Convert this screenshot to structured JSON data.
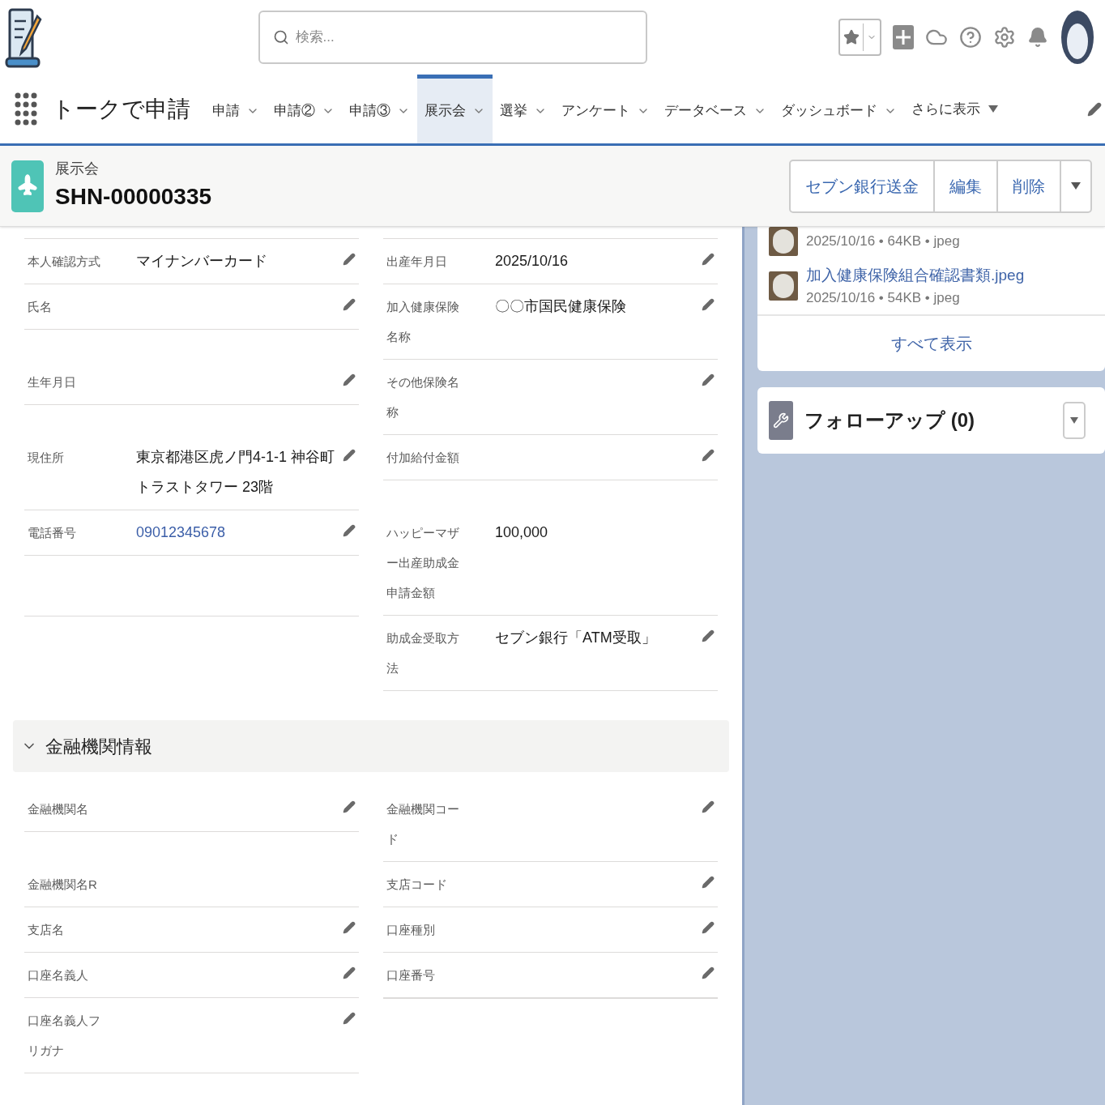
{
  "search": {
    "placeholder": "検索..."
  },
  "nav": {
    "app_name": "トークで申請",
    "tabs": [
      {
        "label": "申請",
        "selected": false
      },
      {
        "label": "申請②",
        "selected": false
      },
      {
        "label": "申請③",
        "selected": false
      },
      {
        "label": "展示会",
        "selected": true
      },
      {
        "label": "選挙",
        "selected": false
      },
      {
        "label": "アンケート",
        "selected": false
      },
      {
        "label": "データベース",
        "selected": false
      },
      {
        "label": "ダッシュボード",
        "selected": false
      }
    ],
    "more": "さらに表示"
  },
  "record": {
    "object": "展示会",
    "title": "SHN-00000335",
    "actions": [
      "セブン銀行送金",
      "編集",
      "削除"
    ]
  },
  "sections": [
    {
      "rows": [
        {
          "left": {
            "label": "本人確認方式",
            "value": "マイナンバーカード",
            "link": false,
            "editable": true
          },
          "right": {
            "label": "出産年月日",
            "value": "2025/10/16",
            "link": false,
            "editable": true
          }
        },
        {
          "left": {
            "label": "氏名",
            "editable": true
          },
          "right": {
            "label": "加入健康保険名称",
            "value": "〇〇市国民健康保険",
            "link": false,
            "editable": true
          }
        },
        {
          "left": {
            "label": "生年月日",
            "editable": true
          },
          "right": {
            "label": "その他保険名称",
            "editable": true
          }
        },
        {
          "left": {
            "label": "現住所",
            "value": "東京都港区虎ノ門4-1-1 神谷町トラストタワー 23階",
            "link": false,
            "editable": true
          },
          "right": {
            "label": "付加給付金額",
            "editable": true
          }
        },
        {
          "left": {
            "label": "電話番号",
            "value": "09012345678",
            "link": true,
            "editable": true
          },
          "right": {
            "label": "ハッピーマザー出産助成金申請金額",
            "value": "100,000",
            "link": false,
            "editable": false
          }
        },
        {
          "right": {
            "label": "助成金受取方法",
            "value": "セブン銀行「ATM受取」",
            "link": false,
            "editable": true
          }
        }
      ]
    },
    {
      "title": "金融機関情報",
      "expanded": true,
      "rows": [
        {
          "left": {
            "label": "金融機関名",
            "editable": true
          },
          "right": {
            "label": "金融機関コード",
            "editable": true
          }
        },
        {
          "left": {
            "label": "金融機関名R",
            "editable": false
          },
          "right": {
            "label": "支店コード",
            "editable": true
          }
        },
        {
          "left": {
            "label": "支店名",
            "editable": true
          },
          "right": {
            "label": "口座種別",
            "editable": true
          }
        },
        {
          "left": {
            "label": "口座名義人",
            "editable": true
          },
          "right": {
            "label": "口座番号",
            "editable": true
          }
        },
        {
          "left": {
            "label": "口座名義人フリガナ",
            "editable": true
          }
        }
      ]
    }
  ],
  "files": {
    "items": [
      {
        "meta": "2025/10/16 • 64KB • jpeg"
      },
      {
        "name": "加入健康保険組合確認書類.jpeg",
        "meta": "2025/10/16 • 54KB • jpeg"
      }
    ],
    "view_all": "すべて表示"
  },
  "followup": {
    "title": "フォローアップ (0)"
  }
}
